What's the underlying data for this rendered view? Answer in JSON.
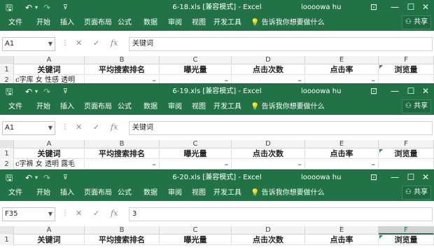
{
  "common": {
    "user": "loooowa hu",
    "tabs": [
      "文件",
      "开始",
      "插入",
      "页面布局",
      "公式",
      "数据",
      "审阅",
      "视图",
      "开发工具"
    ],
    "tell_me": "告诉我你想要做什么",
    "share": "共享",
    "cancel_symbol": "✕",
    "enter_symbol": "✓",
    "fx_symbol": "fx"
  },
  "windows": [
    {
      "title": "6-18.xls  [兼容模式]  -  Excel",
      "name_box": "A1",
      "formula": "关键词",
      "columns": [
        "A",
        "B",
        "C",
        "D",
        "E",
        "F"
      ],
      "rows": [
        {
          "num": "1",
          "cells": [
            "关键词",
            "平均搜索排名",
            "曝光量",
            "点击次数",
            "点击率",
            "浏览量"
          ]
        },
        {
          "num": "2",
          "cells": [
            "c字库 女 性感 透明",
            "–",
            "–",
            "–",
            "–",
            ""
          ]
        }
      ]
    },
    {
      "title": "6-19.xls  [兼容模式]  -  Excel",
      "name_box": "A1",
      "formula": "关键词",
      "columns": [
        "A",
        "B",
        "C",
        "D",
        "E",
        "F"
      ],
      "rows": [
        {
          "num": "1",
          "cells": [
            "关键词",
            "平均搜索排名",
            "曝光量",
            "点击次数",
            "点击率",
            "浏览量"
          ]
        },
        {
          "num": "2",
          "cells": [
            "c字裤 女 透明 露毛",
            "–",
            "–",
            "–",
            "–",
            ""
          ]
        }
      ]
    },
    {
      "title": "6-20.xls  [兼容模式]  -  Excel",
      "name_box": "F35",
      "formula": "3",
      "columns": [
        "A",
        "B",
        "C",
        "D",
        "E",
        "F"
      ],
      "rows": [
        {
          "num": "1",
          "cells": [
            "关键词",
            "平均搜索排名",
            "曝光量",
            "点击次数",
            "点击率",
            "浏览量"
          ]
        }
      ]
    }
  ]
}
